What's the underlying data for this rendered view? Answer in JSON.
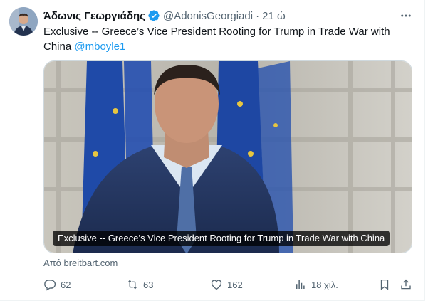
{
  "tweet": {
    "display_name": "Άδωνις Γεωργιάδης",
    "handle": "@AdonisGeorgiadi",
    "separator": "·",
    "time": "21 ώ",
    "text": "Exclusive -- Greece’s Vice President Rooting for Trump in Trade War with China",
    "mention": "@mboyle1"
  },
  "card": {
    "caption": "Exclusive -- Greece’s Vice President Rooting for Trump in Trade War with China",
    "source": "Από breitbart.com"
  },
  "actions": {
    "replies": "62",
    "retweets": "63",
    "likes": "162",
    "views": "18 χιλ."
  },
  "icons": [
    "verified-badge-icon",
    "more-icon",
    "reply-icon",
    "retweet-icon",
    "like-icon",
    "views-icon",
    "bookmark-icon",
    "share-icon"
  ],
  "colors": {
    "accent": "#1d9bf0",
    "muted": "#536471",
    "text": "#0f1419"
  }
}
